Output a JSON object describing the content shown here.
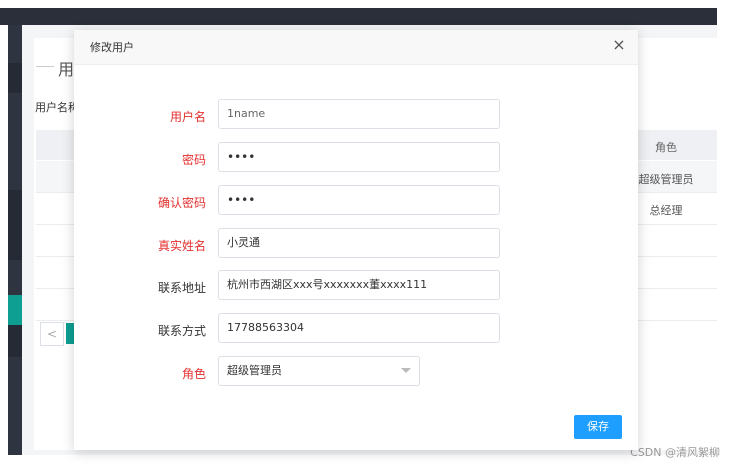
{
  "background": {
    "page_title": "用",
    "filter_label": "用户名称",
    "table": {
      "visible_column_header": "角色",
      "visible_cells": [
        "超级管理员",
        "总经理"
      ]
    },
    "pager_prev": "<"
  },
  "dialog": {
    "title": "修改用户",
    "close_glyph": "×",
    "fields": [
      {
        "label": "用户名",
        "value": "1name",
        "required": true
      },
      {
        "label": "密码",
        "value": "••••",
        "required": true
      },
      {
        "label": "确认密码",
        "value": "••••",
        "required": true
      },
      {
        "label": "真实姓名",
        "value": "小灵通",
        "required": true
      },
      {
        "label": "联系地址",
        "value": "杭州市西湖区xxx号xxxxxxx董xxxx111",
        "required": false
      },
      {
        "label": "联系方式",
        "value": "17788563304",
        "required": false
      },
      {
        "label": "角色",
        "value": "超级管理员",
        "required": true
      }
    ],
    "save_label": "保存"
  },
  "watermark": "CSDN @清风絮柳",
  "colors": {
    "required_label": "#e3302f",
    "primary_button": "#1e9fff",
    "sidebar_active": "#0f9e92",
    "topbar": "#2b2f3a"
  },
  "icons": [
    "close-icon",
    "chevron-down-icon",
    "arrow-left-icon"
  ]
}
